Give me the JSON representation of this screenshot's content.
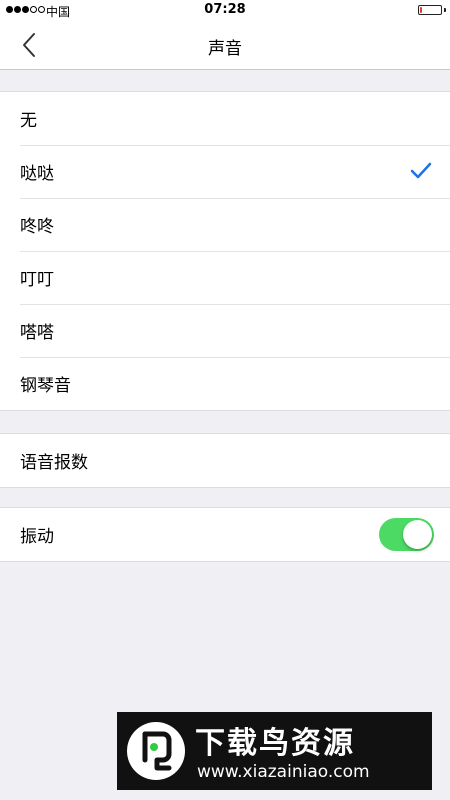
{
  "status_bar": {
    "carrier": "中国",
    "time": "07:28",
    "signal_bars": 3,
    "signal_total": 5,
    "battery_level": 0.1,
    "battery_color": "#e33b30"
  },
  "nav": {
    "title": "声音",
    "back_icon": "chevron-left-icon"
  },
  "sound_options": {
    "items": [
      {
        "label": "无",
        "selected": false
      },
      {
        "label": "哒哒",
        "selected": true
      },
      {
        "label": "咚咚",
        "selected": false
      },
      {
        "label": "叮叮",
        "selected": false
      },
      {
        "label": "嗒嗒",
        "selected": false
      },
      {
        "label": "钢琴音",
        "selected": false
      }
    ],
    "check_icon": "checkmark-icon",
    "check_color": "#1a73e8"
  },
  "voice": {
    "label": "语音报数"
  },
  "vibration": {
    "label": "振动",
    "enabled": true,
    "toggle_on_color": "#4cd964"
  },
  "watermark": {
    "title": "下载鸟资源",
    "url": "www.xiazainiao.com"
  }
}
